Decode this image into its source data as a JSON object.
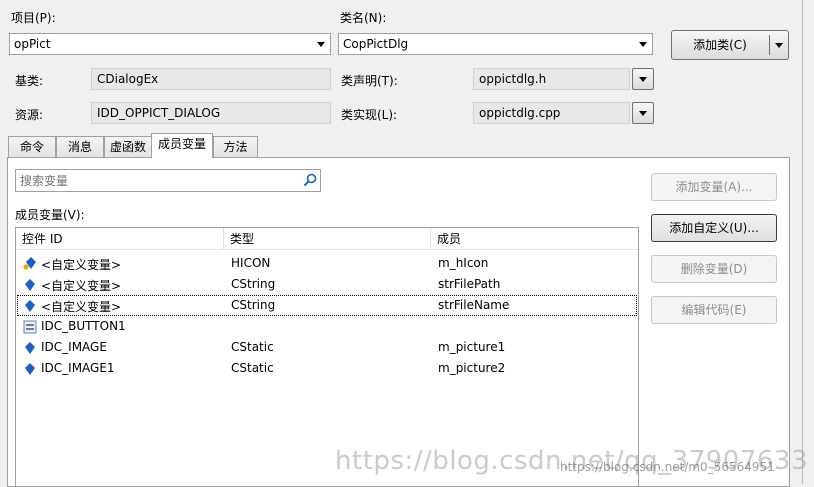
{
  "project": {
    "label": "项目(P):",
    "value": "opPict"
  },
  "classname": {
    "label": "类名(N):",
    "value": "CopPictDlg"
  },
  "add_class_button": {
    "label": "添加类(C)"
  },
  "base_class": {
    "label": "基类:",
    "value": "CDialogEx"
  },
  "class_decl": {
    "label": "类声明(T):",
    "value": "oppictdlg.h"
  },
  "resource": {
    "label": "资源:",
    "value": "IDD_OPPICT_DIALOG"
  },
  "class_impl": {
    "label": "类实现(L):",
    "value": "oppictdlg.cpp"
  },
  "tabs": [
    {
      "label": "命令"
    },
    {
      "label": "消息"
    },
    {
      "label": "虚函数"
    },
    {
      "label": "成员变量"
    },
    {
      "label": "方法"
    }
  ],
  "search": {
    "placeholder": "搜索变量"
  },
  "members_label": "成员变量(V):",
  "grid": {
    "headers": [
      "控件 ID",
      "类型",
      "成员"
    ],
    "rows": [
      {
        "id": "<自定义变量>",
        "type": "HICON",
        "member": "m_hIcon"
      },
      {
        "id": "<自定义变量>",
        "type": "CString",
        "member": "strFilePath"
      },
      {
        "id": "<自定义变量>",
        "type": "CString",
        "member": "strFileName"
      },
      {
        "id": "IDC_BUTTON1",
        "type": "",
        "member": ""
      },
      {
        "id": "IDC_IMAGE",
        "type": "CStatic",
        "member": "m_picture1"
      },
      {
        "id": "IDC_IMAGE1",
        "type": "CStatic",
        "member": "m_picture2"
      }
    ]
  },
  "buttons": {
    "add_variable": "添加变量(A)...",
    "add_custom": "添加自定义(U)...",
    "delete_variable": "删除变量(D)",
    "edit_code": "编辑代码(E)"
  },
  "watermark": {
    "large": "https://blog.csdn.net/qq_37907633",
    "small": "https://blog.csdn.net/m0_56564951"
  },
  "colors": {
    "icon_blue": "#1f5fbf",
    "icon_yellow": "#e0b000",
    "accent": "#3c7fb1"
  }
}
